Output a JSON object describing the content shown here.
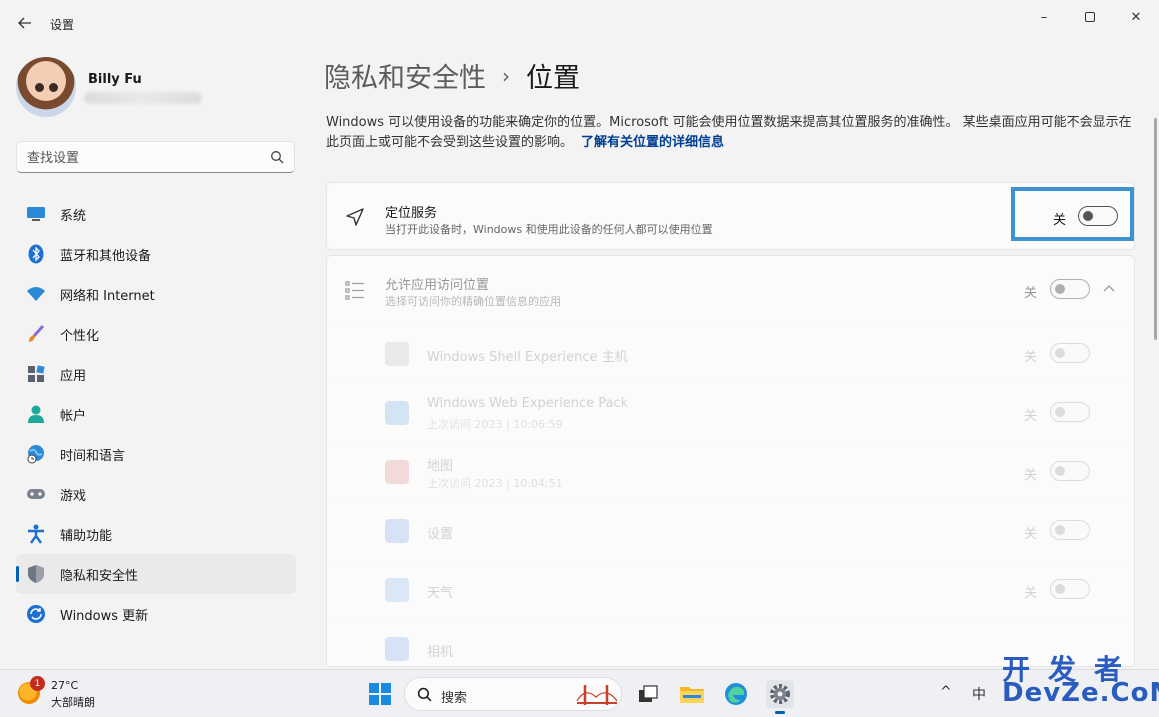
{
  "window": {
    "title": "设置",
    "controls": {
      "minimize": "–",
      "close": "✕"
    }
  },
  "profile": {
    "name": "Billy Fu"
  },
  "search": {
    "placeholder": "查找设置"
  },
  "sidebar": {
    "items": [
      {
        "label": "系统",
        "icon": "system-icon"
      },
      {
        "label": "蓝牙和其他设备",
        "icon": "bluetooth-icon"
      },
      {
        "label": "网络和 Internet",
        "icon": "wifi-icon"
      },
      {
        "label": "个性化",
        "icon": "brush-icon"
      },
      {
        "label": "应用",
        "icon": "apps-icon"
      },
      {
        "label": "帐户",
        "icon": "account-icon"
      },
      {
        "label": "时间和语言",
        "icon": "globe-clock-icon"
      },
      {
        "label": "游戏",
        "icon": "gamepad-icon"
      },
      {
        "label": "辅助功能",
        "icon": "accessibility-icon"
      },
      {
        "label": "隐私和安全性",
        "icon": "shield-icon",
        "active": true
      },
      {
        "label": "Windows 更新",
        "icon": "update-icon"
      }
    ]
  },
  "main": {
    "breadcrumb": {
      "parent": "隐私和安全性",
      "separator": "›",
      "current": "位置"
    },
    "intro": {
      "text": "Windows 可以使用设备的功能来确定你的位置。Microsoft 可能会使用位置数据来提高其位置服务的准确性。 某些桌面应用可能不会显示在此页面上或可能不会受到这些设置的影响。",
      "link": "了解有关位置的详细信息"
    },
    "location_service": {
      "title": "定位服务",
      "subtitle": "当打开此设备时，Windows 和使用此设备的任何人都可以使用位置",
      "state": "关",
      "on": false
    },
    "app_access": {
      "title": "允许应用访问位置",
      "subtitle": "选择可访问你的精确位置信息的应用",
      "state": "关",
      "expand_icon": "chevron-up-icon",
      "apps": [
        {
          "name": "Windows Shell Experience 主机",
          "sub": "",
          "state": "关",
          "color": "#9a9a9a"
        },
        {
          "name": "Windows Web Experience Pack",
          "sub": "上次访问 2023 | 10:06:59",
          "state": "关",
          "color": "#2f7fd0"
        },
        {
          "name": "地图",
          "sub": "上次访问 2023 | 10:04:51",
          "state": "关",
          "color": "#d14a4a"
        },
        {
          "name": "设置",
          "sub": "",
          "state": "关",
          "color": "#3b7ddd"
        },
        {
          "name": "天气",
          "sub": "",
          "state": "关",
          "color": "#4a8fd9"
        },
        {
          "name": "相机",
          "sub": "",
          "state": "关",
          "color": "#3a7bd5"
        }
      ]
    }
  },
  "taskbar": {
    "weather": {
      "temp": "27°C",
      "desc": "大部晴朗",
      "badge": "1"
    },
    "search_label": "搜索",
    "tray": {
      "chevron": "^",
      "ime": "中"
    }
  },
  "watermark": {
    "top": "开发者",
    "bottom": "DevZe.CoM"
  },
  "colors": {
    "accent": "#005fb8",
    "highlight": "#3d93d1"
  }
}
